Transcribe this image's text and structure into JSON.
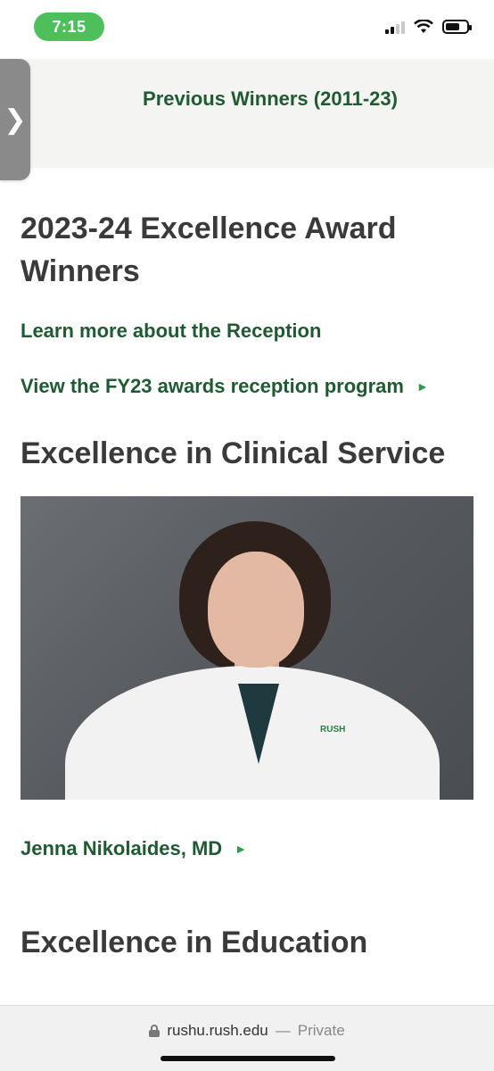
{
  "status_bar": {
    "time": "7:15",
    "signal_icon": "cellular-signal-icon",
    "wifi_icon": "wifi-icon",
    "battery_icon": "battery-icon",
    "battery_level": 0.7
  },
  "side_tab": {
    "glyph": "❯",
    "icon": "chevron-right-icon"
  },
  "previous_winners": {
    "label": "Previous Winners (2011-23)"
  },
  "main": {
    "title": "2023-24 Excellence Award Winners",
    "links": {
      "reception": "Learn more about the Reception",
      "program": "View the FY23 awards reception program",
      "arrow": "►"
    },
    "sections": {
      "clinical": {
        "title": "Excellence in Clinical Service",
        "winner_name": "Jenna Nikolaides, MD",
        "photo_badge": "RUSH"
      },
      "education": {
        "title": "Excellence in Education"
      }
    }
  },
  "browser": {
    "domain": "rushu.rush.edu",
    "separator": "—",
    "mode": "Private",
    "lock_icon": "lock-icon"
  },
  "colors": {
    "green_link": "#1f5a32",
    "arrow_green": "#2f9a4e",
    "heading": "#3a3a3a",
    "time_pill": "#4fbf5c"
  }
}
